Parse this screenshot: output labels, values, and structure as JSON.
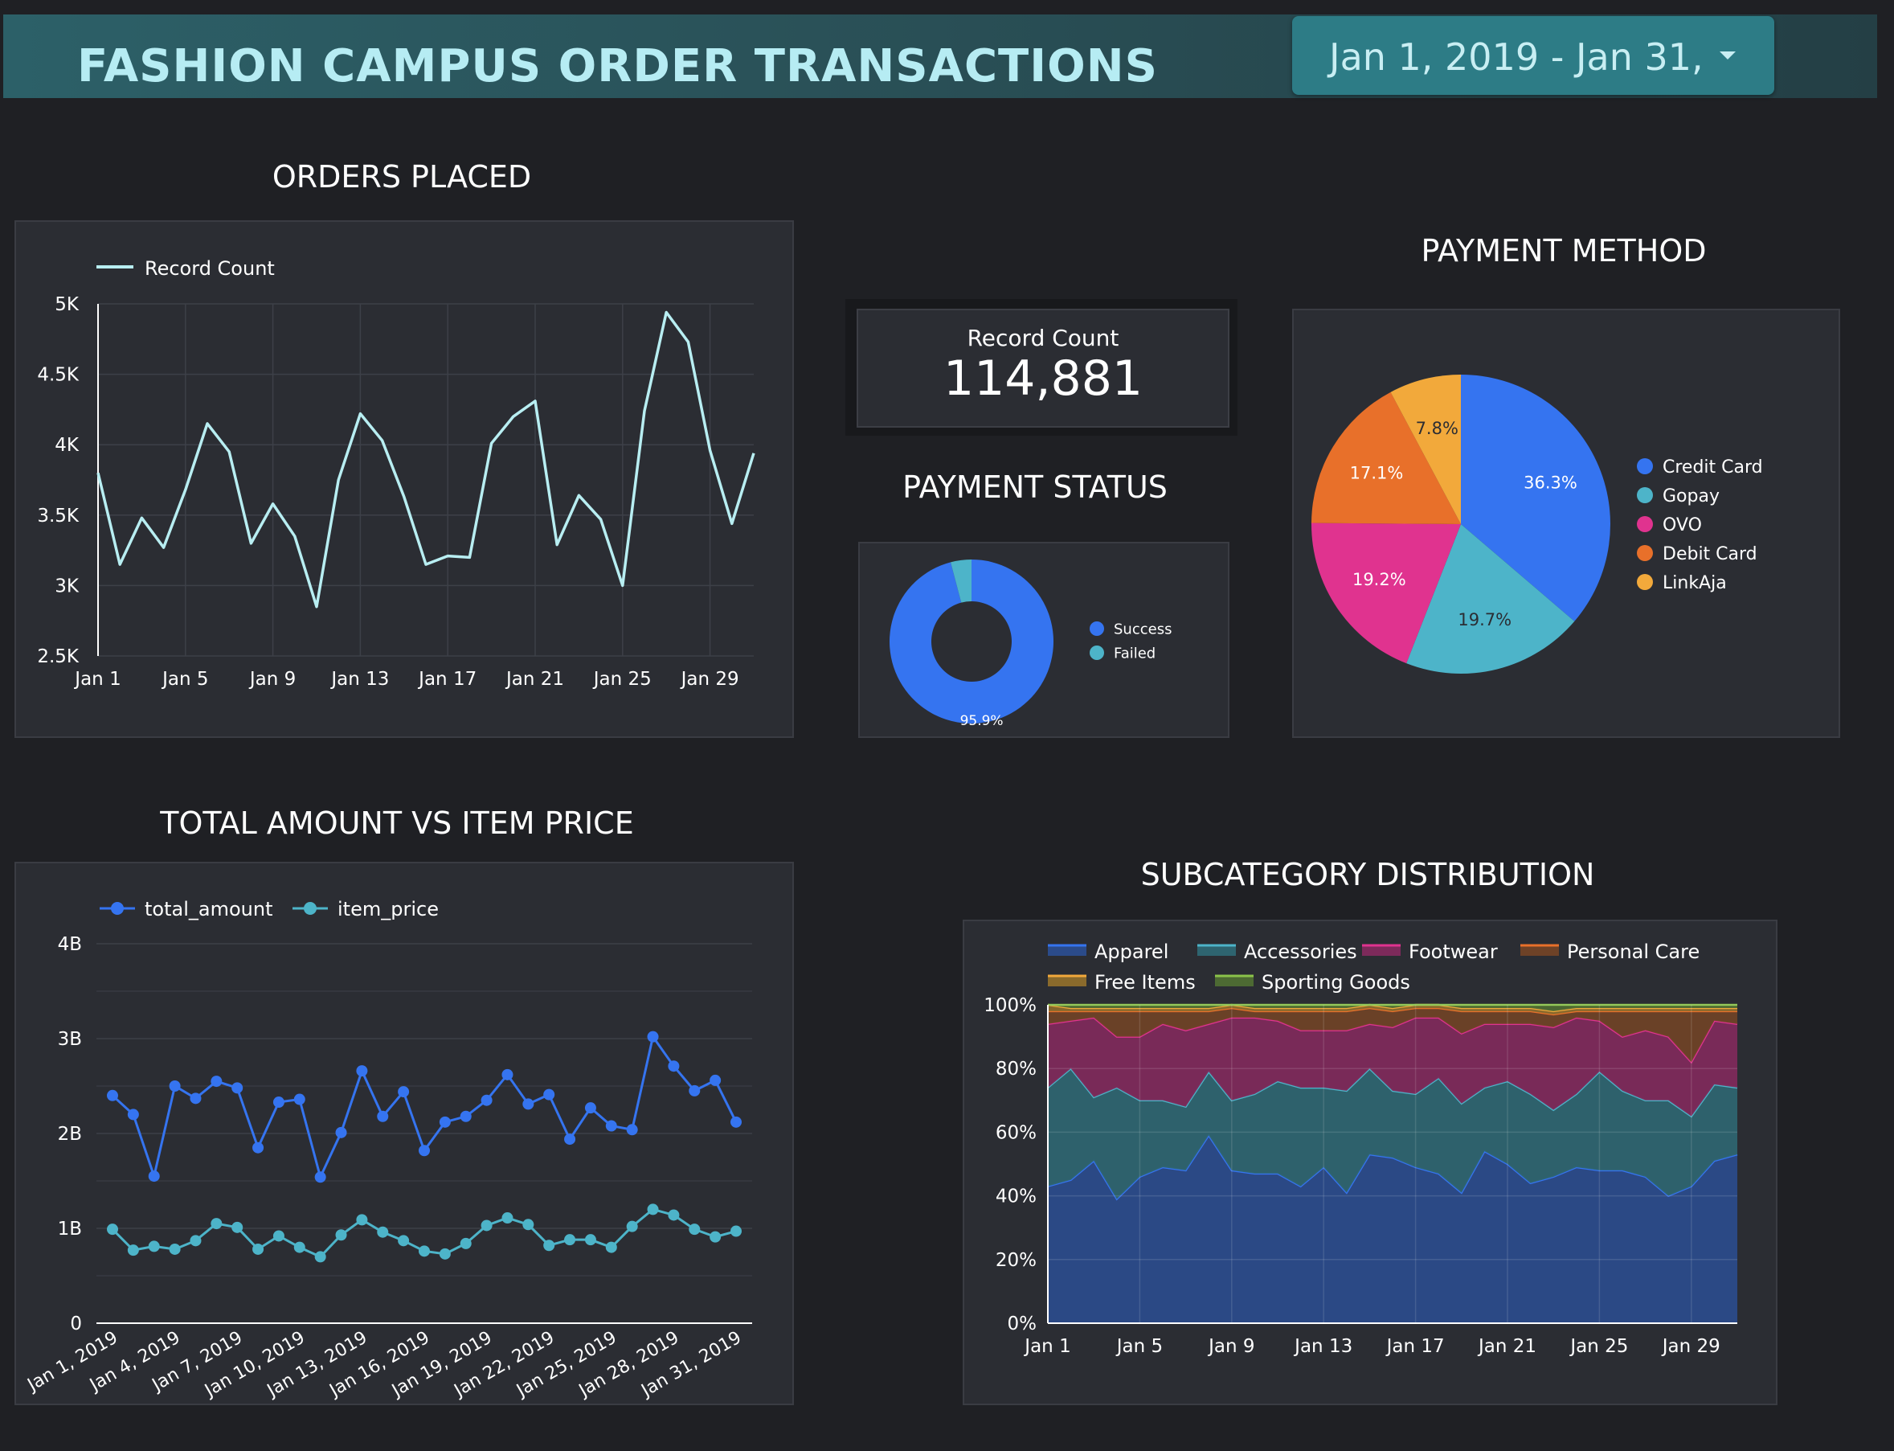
{
  "header": {
    "title": "FASHION CAMPUS ORDER TRANSACTIONS",
    "date_range": "Jan 1, 2019 - Jan 31,"
  },
  "sections": {
    "orders_title": "ORDERS PLACED",
    "payment_method_title": "PAYMENT METHOD",
    "payment_status_title": "PAYMENT STATUS",
    "amount_title": "TOTAL AMOUNT VS ITEM PRICE",
    "subcategory_title": "SUBCATEGORY DISTRIBUTION"
  },
  "scorecard": {
    "label": "Record Count",
    "value": "114,881"
  },
  "colors": {
    "background": "#1f2024",
    "card": "#2b2d33",
    "accent": "#2d7c86",
    "title": "#b6ecf3"
  },
  "chart_data": [
    {
      "id": "orders",
      "type": "line",
      "legend": "top-left",
      "series": [
        {
          "name": "Record Count",
          "color": "#b8eef2",
          "values": [
            3800,
            3150,
            3480,
            3270,
            3680,
            4150,
            3950,
            3300,
            3580,
            3350,
            2850,
            3750,
            4220,
            4030,
            3630,
            3150,
            3210,
            3200,
            4010,
            4200,
            4310,
            3290,
            3640,
            3470,
            3000,
            4240,
            4940,
            4730,
            3960,
            3440,
            3940
          ]
        }
      ],
      "x": [
        "Jan 1",
        "Jan 2",
        "Jan 3",
        "Jan 4",
        "Jan 5",
        "Jan 6",
        "Jan 7",
        "Jan 8",
        "Jan 9",
        "Jan 10",
        "Jan 11",
        "Jan 12",
        "Jan 13",
        "Jan 14",
        "Jan 15",
        "Jan 16",
        "Jan 17",
        "Jan 18",
        "Jan 19",
        "Jan 20",
        "Jan 21",
        "Jan 22",
        "Jan 23",
        "Jan 24",
        "Jan 25",
        "Jan 26",
        "Jan 27",
        "Jan 28",
        "Jan 29",
        "Jan 30",
        "Jan 31"
      ],
      "x_tick_labels": [
        "Jan 1",
        "Jan 5",
        "Jan 9",
        "Jan 13",
        "Jan 17",
        "Jan 21",
        "Jan 25",
        "Jan 29"
      ],
      "ylim": [
        2500,
        5000
      ],
      "y_tick_labels": [
        "2.5K",
        "3K",
        "3.5K",
        "4K",
        "4.5K",
        "5K"
      ],
      "grid": true
    },
    {
      "id": "payment_status",
      "type": "pie",
      "donut": true,
      "legend": "right",
      "slices": [
        {
          "name": "Success",
          "value": 95.9,
          "color": "#3574f0",
          "label": "95.9%"
        },
        {
          "name": "Failed",
          "value": 4.1,
          "color": "#4db4c9",
          "label": ""
        }
      ]
    },
    {
      "id": "payment_method",
      "type": "pie",
      "legend": "right",
      "slices": [
        {
          "name": "Credit Card",
          "value": 36.3,
          "color": "#3574f0",
          "label": "36.3%"
        },
        {
          "name": "Gopay",
          "value": 19.7,
          "color": "#4db4c9",
          "label": "19.7%"
        },
        {
          "name": "OVO",
          "value": 19.2,
          "color": "#e0338f",
          "label": "19.2%"
        },
        {
          "name": "Debit Card",
          "value": 17.1,
          "color": "#e8702a",
          "label": "17.1%"
        },
        {
          "name": "LinkAja",
          "value": 7.8,
          "color": "#f2a93b",
          "label": "7.8%"
        }
      ]
    },
    {
      "id": "amount_vs_price",
      "type": "line",
      "markers": true,
      "legend": "top-left",
      "series": [
        {
          "name": "total_amount",
          "color": "#3574f0",
          "values": [
            2.4,
            2.2,
            1.55,
            2.5,
            2.37,
            2.55,
            2.48,
            1.85,
            2.33,
            2.36,
            1.54,
            2.01,
            2.66,
            2.18,
            2.44,
            1.82,
            2.12,
            2.18,
            2.35,
            2.62,
            2.31,
            2.41,
            1.94,
            2.27,
            2.08,
            2.04,
            3.02,
            2.71,
            2.45,
            2.56,
            2.12
          ]
        },
        {
          "name": "item_price",
          "color": "#4db4c9",
          "values": [
            0.99,
            0.77,
            0.81,
            0.78,
            0.87,
            1.05,
            1.01,
            0.78,
            0.92,
            0.8,
            0.7,
            0.93,
            1.09,
            0.96,
            0.87,
            0.76,
            0.73,
            0.84,
            1.03,
            1.11,
            1.04,
            0.82,
            0.88,
            0.88,
            0.8,
            1.02,
            1.2,
            1.14,
            0.99,
            0.91,
            0.97
          ]
        }
      ],
      "x": [
        "Jan 1, 2019",
        "Jan 2, 2019",
        "Jan 3, 2019",
        "Jan 4, 2019",
        "Jan 5, 2019",
        "Jan 6, 2019",
        "Jan 7, 2019",
        "Jan 8, 2019",
        "Jan 9, 2019",
        "Jan 10, 2019",
        "Jan 11, 2019",
        "Jan 12, 2019",
        "Jan 13, 2019",
        "Jan 14, 2019",
        "Jan 15, 2019",
        "Jan 16, 2019",
        "Jan 17, 2019",
        "Jan 18, 2019",
        "Jan 19, 2019",
        "Jan 20, 2019",
        "Jan 21, 2019",
        "Jan 22, 2019",
        "Jan 23, 2019",
        "Jan 24, 2019",
        "Jan 25, 2019",
        "Jan 26, 2019",
        "Jan 27, 2019",
        "Jan 28, 2019",
        "Jan 29, 2019",
        "Jan 30, 2019",
        "Jan 31, 2019"
      ],
      "x_tick_labels": [
        "Jan 1, 2019",
        "Jan 4, 2019",
        "Jan 7, 2019",
        "Jan 10, 2019",
        "Jan 13, 2019",
        "Jan 16, 2019",
        "Jan 19, 2019",
        "Jan 22, 2019",
        "Jan 25, 2019",
        "Jan 28, 2019",
        "Jan 31, 2019"
      ],
      "y_unit": "B",
      "ylim": [
        0,
        4
      ],
      "y_tick_labels": [
        "0",
        "1B",
        "2B",
        "3B",
        "4B"
      ],
      "grid": true
    },
    {
      "id": "subcategory",
      "type": "area",
      "stacked": true,
      "normalized": true,
      "legend": "top",
      "x": [
        "Jan 1",
        "Jan 2",
        "Jan 3",
        "Jan 4",
        "Jan 5",
        "Jan 6",
        "Jan 7",
        "Jan 8",
        "Jan 9",
        "Jan 10",
        "Jan 11",
        "Jan 12",
        "Jan 13",
        "Jan 14",
        "Jan 15",
        "Jan 16",
        "Jan 17",
        "Jan 18",
        "Jan 19",
        "Jan 20",
        "Jan 21",
        "Jan 22",
        "Jan 23",
        "Jan 24",
        "Jan 25",
        "Jan 26",
        "Jan 27",
        "Jan 28",
        "Jan 29",
        "Jan 30",
        "Jan 31"
      ],
      "x_tick_labels": [
        "Jan 1",
        "Jan 5",
        "Jan 9",
        "Jan 13",
        "Jan 17",
        "Jan 21",
        "Jan 25",
        "Jan 29"
      ],
      "y_tick_labels": [
        "0%",
        "20%",
        "40%",
        "60%",
        "80%",
        "100%"
      ],
      "ylim": [
        0,
        100
      ],
      "series": [
        {
          "name": "Apparel",
          "color": "#3574f0",
          "fill": "#2b4b8a",
          "values": [
            43,
            45,
            51,
            39,
            46,
            49,
            48,
            59,
            48,
            47,
            47,
            43,
            49,
            41,
            53,
            52,
            49,
            47,
            41,
            54,
            50,
            44,
            46,
            49,
            48,
            48,
            46,
            40,
            43,
            51,
            53
          ]
        },
        {
          "name": "Accessories",
          "color": "#4db4c9",
          "fill": "#2e6470",
          "values": [
            31,
            35,
            20,
            35,
            24,
            21,
            20,
            20,
            22,
            25,
            29,
            31,
            25,
            32,
            27,
            21,
            23,
            30,
            28,
            20,
            26,
            28,
            21,
            23,
            31,
            25,
            24,
            30,
            22,
            24,
            21
          ]
        },
        {
          "name": "Footwear",
          "color": "#e0338f",
          "fill": "#7d2a5b",
          "values": [
            20,
            15,
            25,
            16,
            20,
            24,
            24,
            15,
            26,
            24,
            19,
            18,
            18,
            19,
            14,
            20,
            24,
            19,
            22,
            20,
            18,
            22,
            26,
            24,
            16,
            17,
            22,
            20,
            17,
            20,
            20
          ]
        },
        {
          "name": "Personal Care",
          "color": "#e8702a",
          "fill": "#6e4227",
          "values": [
            4,
            3,
            2,
            8,
            8,
            4,
            6,
            4,
            3,
            2,
            3,
            6,
            6,
            6,
            5,
            5,
            3,
            3,
            7,
            4,
            4,
            4,
            4,
            2,
            3,
            8,
            6,
            8,
            16,
            3,
            4
          ]
        },
        {
          "name": "Free Items",
          "color": "#f2a93b",
          "fill": "#8a6a2c",
          "values": [
            2,
            1,
            1,
            1,
            1,
            1,
            1,
            1,
            1,
            1,
            1,
            1,
            1,
            1,
            1,
            1,
            1,
            1,
            1,
            1,
            1,
            1,
            1,
            1,
            1,
            1,
            1,
            1,
            1,
            1,
            1
          ]
        },
        {
          "name": "Sporting Goods",
          "color": "#8bc34a",
          "fill": "#4d6a33",
          "values": [
            0,
            1,
            1,
            1,
            1,
            1,
            1,
            1,
            0,
            1,
            1,
            1,
            1,
            1,
            0,
            1,
            0,
            0,
            1,
            1,
            1,
            1,
            2,
            1,
            1,
            1,
            1,
            1,
            1,
            1,
            1
          ]
        }
      ],
      "grid": true
    }
  ]
}
